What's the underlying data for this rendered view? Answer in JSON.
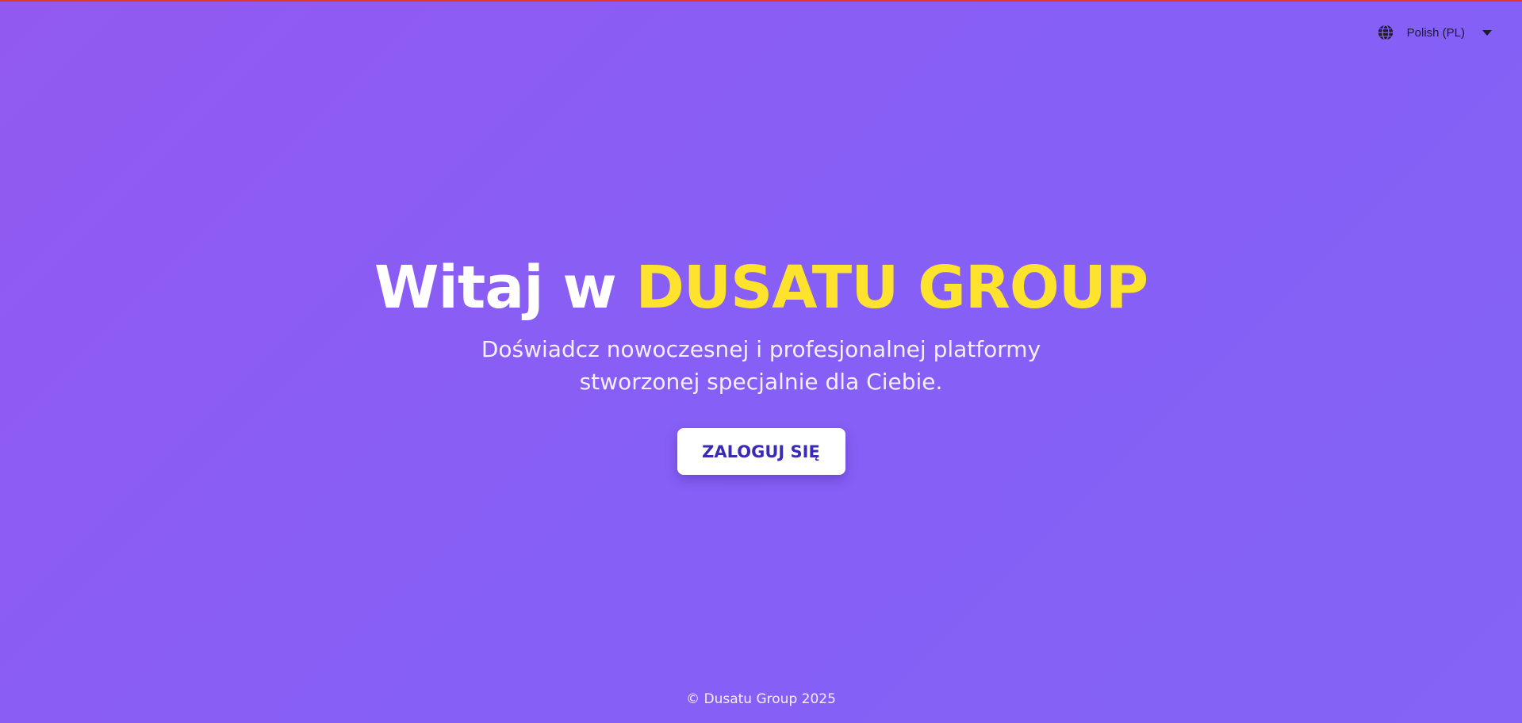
{
  "colors": {
    "accent": "#fde32d",
    "primary_text": "#ffffff",
    "button_text": "#3a2bb7",
    "background_start": "#9259f0",
    "background_end": "#8463f5"
  },
  "language_selector": {
    "icon": "globe-icon",
    "label": "Polish (PL)",
    "caret_icon": "caret-down-icon"
  },
  "hero": {
    "title_prefix": "Witaj w",
    "title_brand": "DUSATU GROUP",
    "subtitle": "Doświadcz nowoczesnej i profesjonalnej platformy stworzonej specjalnie dla Ciebie.",
    "login_label": "ZALOGUJ SIĘ"
  },
  "footer": {
    "copyright": "© Dusatu Group 2025"
  }
}
